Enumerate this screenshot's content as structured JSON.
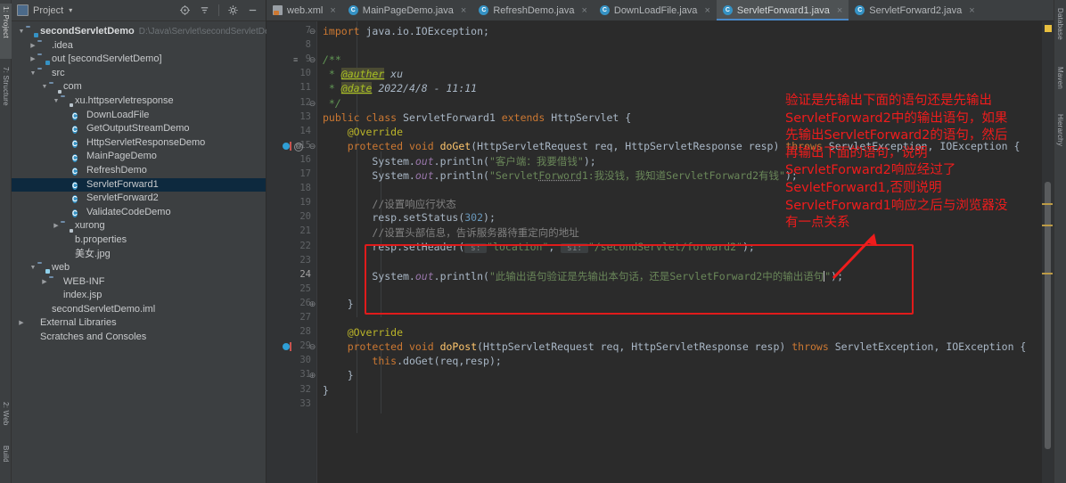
{
  "window": {
    "theme_bg": "#3c3f41",
    "editor_bg": "#2b2b2b",
    "accent": "#4a88c7",
    "annotation_color": "#ef1c1c"
  },
  "left_tool_strip": [
    {
      "label": "1: Project",
      "active": true
    },
    {
      "label": "7: Structure",
      "active": false
    },
    {
      "label": "2: Web",
      "active": false
    },
    {
      "label": "Build",
      "active": false
    }
  ],
  "right_tool_strip": [
    {
      "label": "Database"
    },
    {
      "label": "Maven"
    },
    {
      "label": "Hierarchy"
    }
  ],
  "project_panel": {
    "title": "Project",
    "caret": "▾",
    "tools": [
      {
        "name": "locate-icon",
        "glyph": "⊕"
      },
      {
        "name": "collapse-all-icon",
        "glyph": "⇥"
      },
      {
        "name": "settings-gear-icon",
        "glyph": "⚙"
      },
      {
        "name": "hide-panel-icon",
        "glyph": "—"
      }
    ],
    "tree": [
      {
        "depth": 0,
        "arrow": "▼",
        "icon": "module-folder",
        "label": "secondServletDemo",
        "bold": true,
        "path": "D:\\Java\\Servlet\\secondServletDem",
        "selected": false
      },
      {
        "depth": 1,
        "arrow": "▶",
        "icon": "folder",
        "label": ".idea",
        "bold": false,
        "path": "",
        "selected": false
      },
      {
        "depth": 1,
        "arrow": "▶",
        "icon": "module-folder",
        "label": "out [secondServletDemo]",
        "bold": false,
        "path": "",
        "selected": false
      },
      {
        "depth": 1,
        "arrow": "▼",
        "icon": "source-folder",
        "label": "src",
        "bold": false,
        "path": "",
        "selected": false
      },
      {
        "depth": 2,
        "arrow": "▼",
        "icon": "package",
        "label": "com",
        "bold": false,
        "path": "",
        "selected": false
      },
      {
        "depth": 3,
        "arrow": "▼",
        "icon": "package",
        "label": "xu.httpservletresponse",
        "bold": false,
        "path": "",
        "selected": false
      },
      {
        "depth": 4,
        "arrow": "",
        "icon": "class",
        "label": "DownLoadFile",
        "bold": false,
        "path": "",
        "selected": false
      },
      {
        "depth": 4,
        "arrow": "",
        "icon": "class",
        "label": "GetOutputStreamDemo",
        "bold": false,
        "path": "",
        "selected": false
      },
      {
        "depth": 4,
        "arrow": "",
        "icon": "class",
        "label": "HttpServletResponseDemo",
        "bold": false,
        "path": "",
        "selected": false
      },
      {
        "depth": 4,
        "arrow": "",
        "icon": "class",
        "label": "MainPageDemo",
        "bold": false,
        "path": "",
        "selected": false
      },
      {
        "depth": 4,
        "arrow": "",
        "icon": "class",
        "label": "RefreshDemo",
        "bold": false,
        "path": "",
        "selected": false
      },
      {
        "depth": 4,
        "arrow": "",
        "icon": "class",
        "label": "ServletForward1",
        "bold": false,
        "path": "",
        "selected": true
      },
      {
        "depth": 4,
        "arrow": "",
        "icon": "class",
        "label": "ServletForward2",
        "bold": false,
        "path": "",
        "selected": false
      },
      {
        "depth": 4,
        "arrow": "",
        "icon": "class",
        "label": "ValidateCodeDemo",
        "bold": false,
        "path": "",
        "selected": false
      },
      {
        "depth": 3,
        "arrow": "▶",
        "icon": "package",
        "label": "xurong",
        "bold": false,
        "path": "",
        "selected": false
      },
      {
        "depth": 3,
        "arrow": "",
        "icon": "properties",
        "label": "b.properties",
        "bold": false,
        "path": "",
        "selected": false
      },
      {
        "depth": 3,
        "arrow": "",
        "icon": "image",
        "label": "美女.jpg",
        "bold": false,
        "path": "",
        "selected": false
      },
      {
        "depth": 1,
        "arrow": "▼",
        "icon": "web-folder",
        "label": "web",
        "bold": false,
        "path": "",
        "selected": false
      },
      {
        "depth": 2,
        "arrow": "▶",
        "icon": "folder",
        "label": "WEB-INF",
        "bold": false,
        "path": "",
        "selected": false
      },
      {
        "depth": 2,
        "arrow": "",
        "icon": "jsp",
        "label": "index.jsp",
        "bold": false,
        "path": "",
        "selected": false
      },
      {
        "depth": 1,
        "arrow": "",
        "icon": "iml",
        "label": "secondServletDemo.iml",
        "bold": false,
        "path": "",
        "selected": false
      },
      {
        "depth": 0,
        "arrow": "▶",
        "icon": "library",
        "label": "External Libraries",
        "bold": false,
        "path": "",
        "selected": false
      },
      {
        "depth": 0,
        "arrow": "",
        "icon": "scratches",
        "label": "Scratches and Consoles",
        "bold": false,
        "path": "",
        "selected": false
      }
    ]
  },
  "editor_tabs": [
    {
      "label": "web.xml",
      "icon": "xml-file-icon",
      "active": false
    },
    {
      "label": "MainPageDemo.java",
      "icon": "java-class-icon",
      "active": false
    },
    {
      "label": "RefreshDemo.java",
      "icon": "java-class-icon",
      "active": false
    },
    {
      "label": "DownLoadFile.java",
      "icon": "java-class-icon",
      "active": false
    },
    {
      "label": "ServletForward1.java",
      "icon": "java-class-icon",
      "active": true
    },
    {
      "label": "ServletForward2.java",
      "icon": "java-class-icon",
      "active": false
    }
  ],
  "code": {
    "first_line": 7,
    "last_line": 33,
    "current_line": 24,
    "lines": [
      {
        "n": 7,
        "text": "import java.io.IOException;"
      },
      {
        "n": 8,
        "text": ""
      },
      {
        "n": 9,
        "text": "/**"
      },
      {
        "n": 10,
        "text": " * @auther xu"
      },
      {
        "n": 11,
        "text": " * @date 2022/4/8 - 11:11"
      },
      {
        "n": 12,
        "text": " */"
      },
      {
        "n": 13,
        "text": "public class ServletForward1 extends HttpServlet {"
      },
      {
        "n": 14,
        "text": "    @Override"
      },
      {
        "n": 15,
        "text": "    protected void doGet(HttpServletRequest req, HttpServletResponse resp) throws ServletException, IOException {"
      },
      {
        "n": 16,
        "text": "        System.out.println(\"客户端：我要借钱\");"
      },
      {
        "n": 17,
        "text": "        System.out.println(\"ServletForword1:我没钱，我知道ServletForward2有钱\");"
      },
      {
        "n": 18,
        "text": ""
      },
      {
        "n": 19,
        "text": "        //设置响应行状态"
      },
      {
        "n": 20,
        "text": "        resp.setStatus(302);"
      },
      {
        "n": 21,
        "text": "        //设置头部信息，告诉服务器待重定向的地址"
      },
      {
        "n": 22,
        "text": "        resp.setHeader( s: \"location\", s1: \"/secondServlet/forward2\");"
      },
      {
        "n": 23,
        "text": ""
      },
      {
        "n": 24,
        "text": "        System.out.println(\"此输出语句验证是先输出本句话，还是ServletForward2中的输出语句\");"
      },
      {
        "n": 25,
        "text": ""
      },
      {
        "n": 26,
        "text": "    }"
      },
      {
        "n": 27,
        "text": ""
      },
      {
        "n": 28,
        "text": "    @Override"
      },
      {
        "n": 29,
        "text": "    protected void doPost(HttpServletRequest req, HttpServletResponse resp) throws ServletException, IOException {"
      },
      {
        "n": 30,
        "text": "        this.doGet(req,resp);"
      },
      {
        "n": 31,
        "text": "    }"
      },
      {
        "n": 32,
        "text": "}"
      },
      {
        "n": 33,
        "text": ""
      }
    ],
    "param_hints": [
      "s:",
      "s1:"
    ]
  },
  "annotation": {
    "text": "验证是先输出下面的语句还是先输出ServletForward2中的输出语句，如果先输出ServletForward2的语句，然后再输出下面的语句，说明ServletForward2响应经过了SevletForward1,否则说明ServletForward1响应之后与浏览器没有一点关系",
    "arrow_name": "red-arrow-up-right",
    "box_name": "red-highlight-box"
  },
  "scrollbar": {
    "warning_marker": "#e8bf3f",
    "markers": [
      "#bd9b46",
      "#bd9b46",
      "#bd9b46"
    ]
  }
}
